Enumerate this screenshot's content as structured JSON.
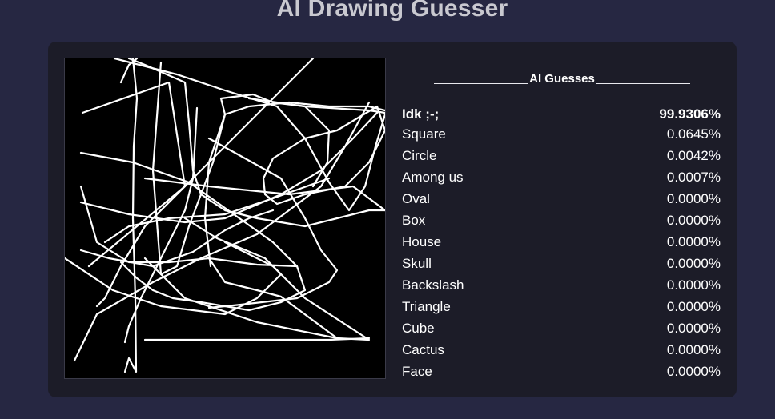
{
  "app": {
    "title": "AI Drawing Guesser"
  },
  "guesses": {
    "header": "AI Guesses",
    "items": [
      {
        "label": "Idk ;-;",
        "value": "99.9306%"
      },
      {
        "label": "Square",
        "value": "0.0645%"
      },
      {
        "label": "Circle",
        "value": "0.0042%"
      },
      {
        "label": "Among us",
        "value": "0.0007%"
      },
      {
        "label": "Oval",
        "value": "0.0000%"
      },
      {
        "label": "Box",
        "value": "0.0000%"
      },
      {
        "label": "House",
        "value": "0.0000%"
      },
      {
        "label": "Skull",
        "value": "0.0000%"
      },
      {
        "label": "Backslash",
        "value": "0.0000%"
      },
      {
        "label": "Triangle",
        "value": "0.0000%"
      },
      {
        "label": "Cube",
        "value": "0.0000%"
      },
      {
        "label": "Cactus",
        "value": "0.0000%"
      },
      {
        "label": "Face",
        "value": "0.0000%"
      }
    ]
  },
  "colors": {
    "page_background": "#262742",
    "panel_background": "#1c1c28",
    "canvas_background": "#000000",
    "stroke": "#ffffff",
    "title_text": "#c9c9d0"
  }
}
